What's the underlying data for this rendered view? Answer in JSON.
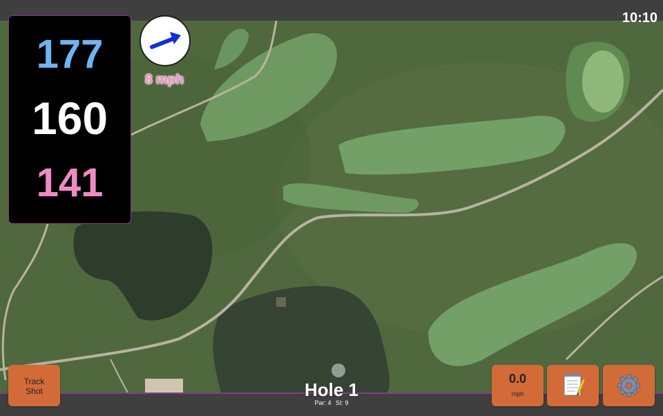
{
  "status_bar": {
    "time": "10:10"
  },
  "distances": {
    "back": "177",
    "middle": "160",
    "front": "141"
  },
  "wind": {
    "speed_label": "8 mph",
    "icon": "wind-direction-arrow-icon"
  },
  "buttons": {
    "track_shot_line1": "Track",
    "track_shot_line2": "Shot",
    "speed_value": "0.0",
    "speed_unit": "mph",
    "notes_icon": "notepad-icon",
    "settings_icon": "gear-icon"
  },
  "hole": {
    "title": "Hole 1",
    "par": "Par: 4",
    "si": "SI: 9"
  },
  "colors": {
    "back_distance": "#6fb3f2",
    "middle_distance": "#ffffff",
    "front_distance": "#f08ac4",
    "button": "#d26b38",
    "accent": "#8a3a8a"
  }
}
